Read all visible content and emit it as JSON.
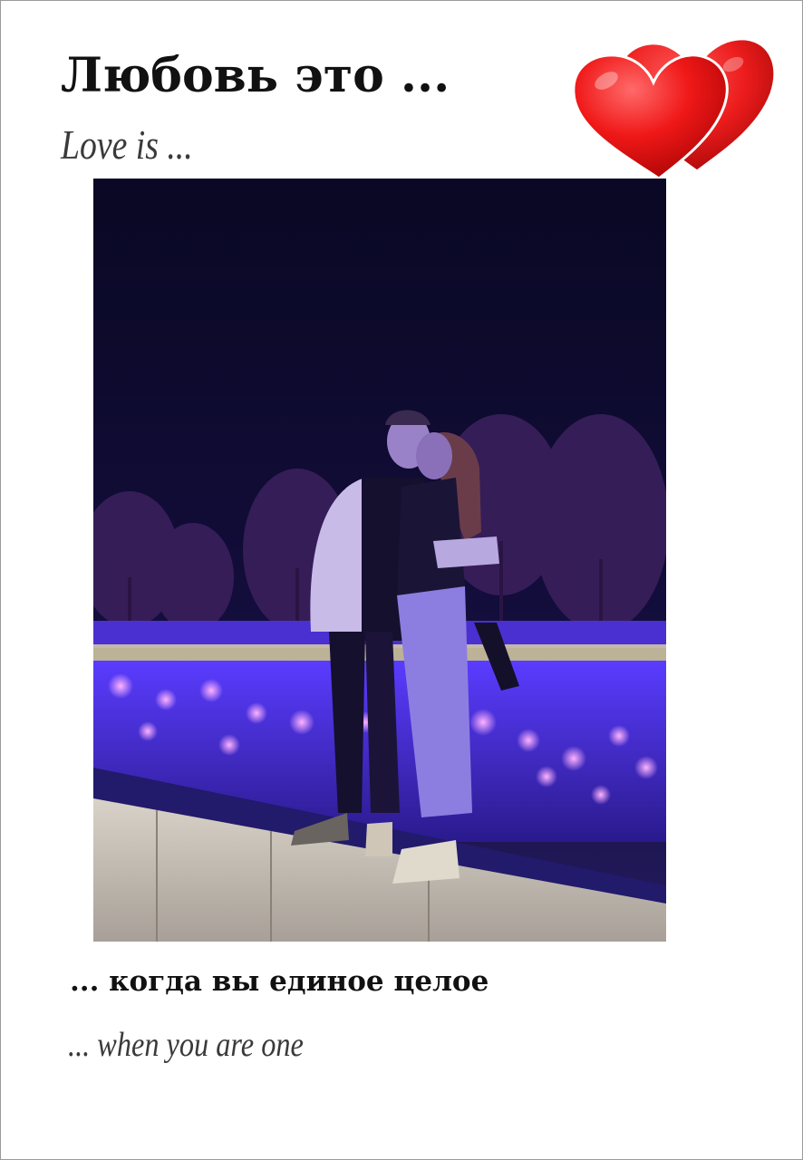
{
  "header": {
    "title_ru": "Любовь это ...",
    "title_en": "Love is ..."
  },
  "decoration": {
    "icon": "two-hearts-icon",
    "heart_color": "#e8121a"
  },
  "photo": {
    "subject": "couple-at-night-photo",
    "light_color": "#6a3cff",
    "sky_color": "#0d0a2e"
  },
  "caption": {
    "text_ru": "... когда вы единое целое",
    "text_en": "... when you are one"
  }
}
